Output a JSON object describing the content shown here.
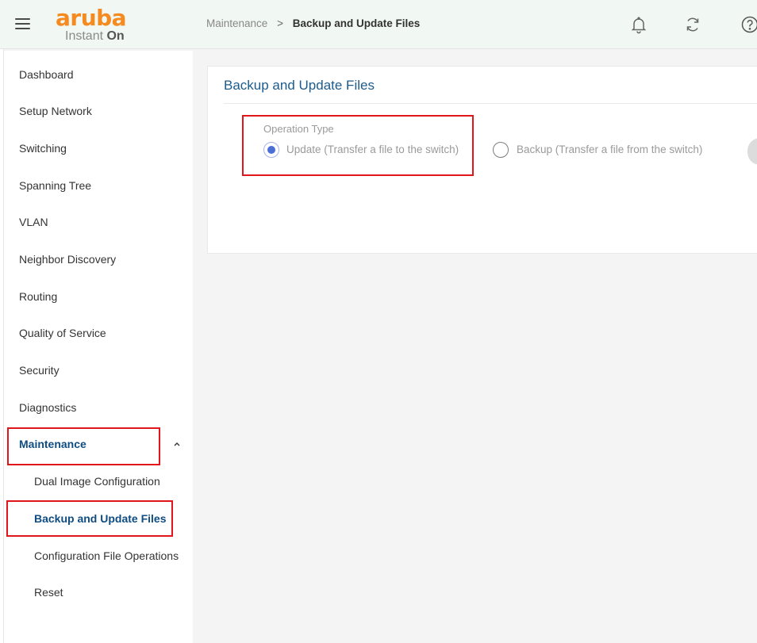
{
  "header": {
    "logo_main": "aruba",
    "logo_sub_prefix": "Instant ",
    "logo_sub_on": "On",
    "breadcrumb": {
      "parent": "Maintenance",
      "separator": ">",
      "current": "Backup and Update Files"
    },
    "icons": [
      "menu-icon",
      "bell-icon",
      "refresh-icon",
      "help-icon"
    ]
  },
  "sidebar": {
    "items": [
      {
        "label": "Dashboard"
      },
      {
        "label": "Setup Network"
      },
      {
        "label": "Switching"
      },
      {
        "label": "Spanning Tree"
      },
      {
        "label": "VLAN"
      },
      {
        "label": "Neighbor Discovery"
      },
      {
        "label": "Routing"
      },
      {
        "label": "Quality of Service"
      },
      {
        "label": "Security"
      },
      {
        "label": "Diagnostics"
      },
      {
        "label": "Maintenance"
      },
      {
        "label": "Dual Image Configuration"
      },
      {
        "label": "Backup and Update Files"
      },
      {
        "label": "Configuration File Operations"
      },
      {
        "label": "Reset"
      }
    ],
    "expanded_caret": "‸"
  },
  "card": {
    "title": "Backup and Update Files",
    "operation_label": "Operation Type",
    "options": [
      {
        "label": "Update (Transfer a file to the switch)",
        "selected": true
      },
      {
        "label": "Backup (Transfer a file from the switch)",
        "selected": false
      }
    ]
  },
  "colors": {
    "brand_orange": "#f58a1f",
    "active_nav": "#0f4c81",
    "highlight_red": "#e0161b",
    "radio_selected": "#4a6fd6"
  }
}
